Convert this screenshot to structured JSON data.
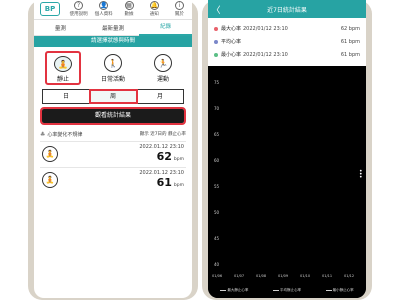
{
  "left": {
    "logo_text": "BP",
    "nav": [
      {
        "icon": "question-icon",
        "glyph": "?",
        "label": "使用說明"
      },
      {
        "icon": "person-icon",
        "glyph": "👤",
        "label": "個人資料"
      },
      {
        "icon": "chart-icon",
        "glyph": "▦",
        "label": "數據"
      },
      {
        "icon": "bell-icon",
        "glyph": "🔔",
        "label": "通知"
      },
      {
        "icon": "info-icon",
        "glyph": "i",
        "label": "關於"
      }
    ],
    "subtabs": [
      "量測",
      "最新量測",
      "紀錄"
    ],
    "prompt": "請選擇狀態與時間",
    "states": [
      {
        "glyph": "🧘",
        "label": "靜止"
      },
      {
        "glyph": "🚶",
        "label": "日常活動"
      },
      {
        "glyph": "🏃",
        "label": "運動"
      }
    ],
    "periods": [
      "日",
      "周",
      "月"
    ],
    "view_button": "觀看統計結果",
    "hr_change": "心率變化不規律",
    "hr_display": "顯示 近7日的 靜止心率",
    "records": [
      {
        "time": "2022.01.12 23:10",
        "value": "62",
        "unit": "bpm"
      },
      {
        "time": "2022.01.12 23:10",
        "value": "61",
        "unit": "bpm"
      }
    ]
  },
  "right": {
    "title": "近7日統計結果",
    "back_glyph": "〈",
    "legend": [
      {
        "name": "最大心率",
        "color": "#e8616b",
        "time": "2022/01/12 23:10",
        "value": "62 bpm"
      },
      {
        "name": "平均心率",
        "color": "#7b87c9",
        "time": "",
        "value": "61 bpm"
      },
      {
        "name": "最小心率",
        "color": "#5bbf86",
        "time": "2022/01/12 23:10",
        "value": "61 bpm"
      }
    ],
    "yticks": [
      "75",
      "70",
      "65",
      "60",
      "55",
      "50",
      "45",
      "40"
    ],
    "xticks": [
      "01/06",
      "01/07",
      "01/08",
      "01/09",
      "01/10",
      "01/11",
      "01/12"
    ],
    "bottom_legend": [
      "最大靜止心率",
      "平均靜止心率",
      "最小靜止心率"
    ]
  }
}
